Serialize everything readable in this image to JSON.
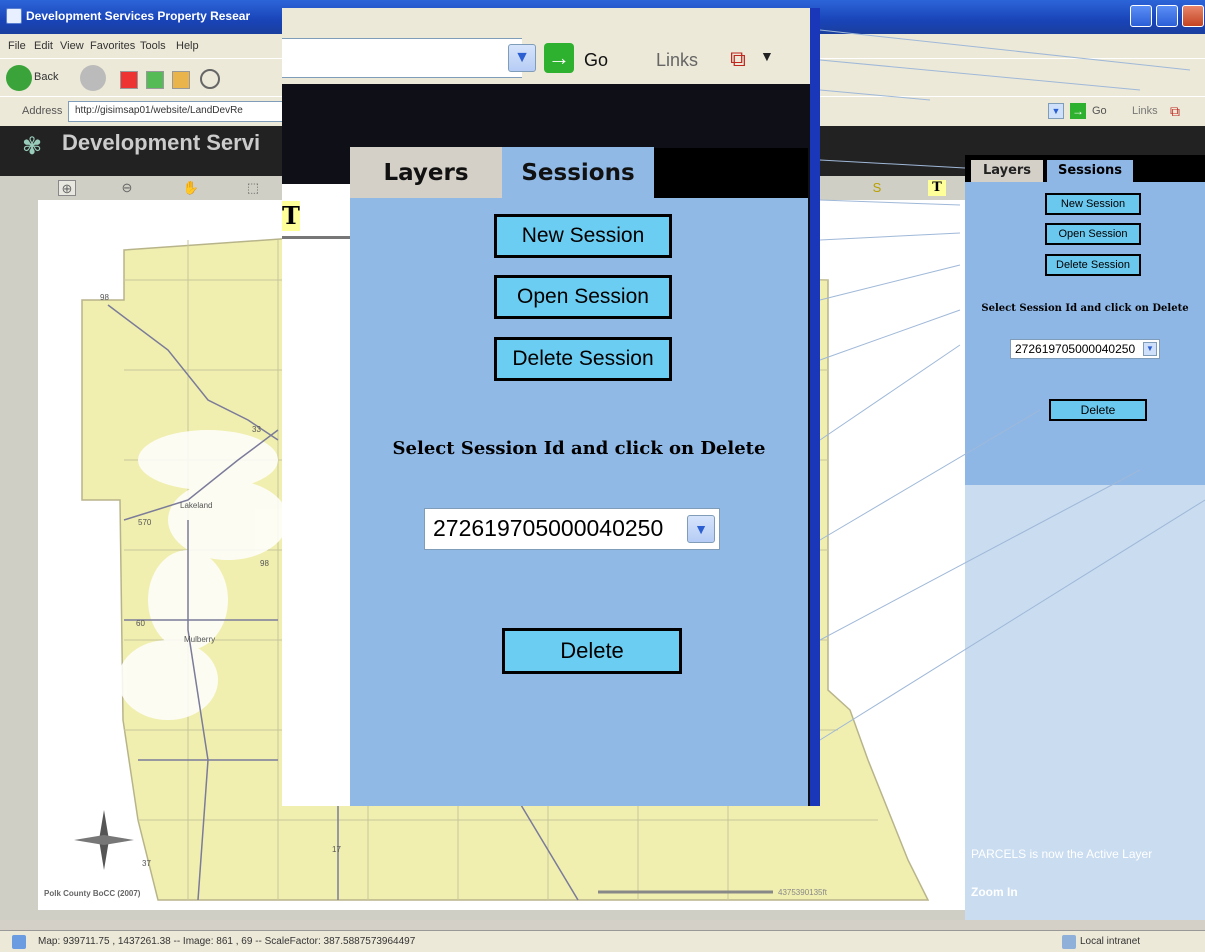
{
  "browser": {
    "window_title": "Development Services Property Resear",
    "menu": [
      "File",
      "Edit",
      "View",
      "Favorites",
      "Tools",
      "Help"
    ],
    "back_label": "Back",
    "address_label": "Address",
    "address_value": "http://gisimsap01/website/LandDevRe",
    "go_label": "Go",
    "links_label": "Links",
    "status_text": "Map: 939711.75 , 1437261.38 -- Image: 861 , 69 -- ScaleFactor: 387.5887573964497",
    "status_zone": "Local intranet"
  },
  "site": {
    "title": "Development Servi",
    "map_tools": [
      "zoom-in",
      "zoom-out",
      "pan",
      "full-extent",
      "identify",
      "text"
    ],
    "map_labels": {
      "city1": "Lakeland",
      "city2": "Mulberry",
      "copyright": "Polk County BoCC (2007)",
      "scale": "4375390135ft",
      "routes": [
        "98",
        "33",
        "98",
        "60",
        "37",
        "17",
        "570"
      ]
    },
    "tool_T": "T",
    "tool_S": "S"
  },
  "panel": {
    "tabs": {
      "layers": "Layers",
      "sessions": "Sessions"
    },
    "new_session": "New Session",
    "open_session": "Open Session",
    "delete_session": "Delete Session",
    "instruction": "Select Session Id and click on Delete",
    "session_id": "272619705000040250",
    "delete_button": "Delete",
    "active_layer_msg": "PARCELS is now the Active Layer",
    "zoom_label": "Zoom In"
  },
  "colors": {
    "panel_blue": "#90b9e6",
    "button_cyan": "#6bcdf1",
    "map_fill": "#f0efb0",
    "title_blue": "#1944b8"
  }
}
